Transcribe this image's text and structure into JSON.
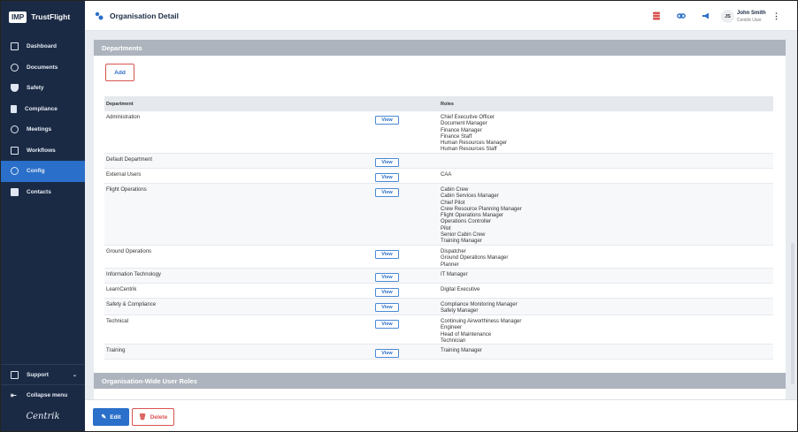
{
  "brand": {
    "logo_text": "IMP",
    "name": "TrustFlight"
  },
  "sidebar": {
    "items": [
      {
        "label": "Dashboard",
        "icon": "dashboard-icon"
      },
      {
        "label": "Documents",
        "icon": "paperclip-icon"
      },
      {
        "label": "Safety",
        "icon": "shield-icon"
      },
      {
        "label": "Compliance",
        "icon": "clipboard-icon"
      },
      {
        "label": "Meetings",
        "icon": "people-icon"
      },
      {
        "label": "Workflows",
        "icon": "workflow-icon"
      },
      {
        "label": "Config",
        "icon": "config-icon"
      },
      {
        "label": "Contacts",
        "icon": "contact-card-icon"
      }
    ],
    "active": "Config",
    "support_label": "Support",
    "collapse_label": "Collapse menu",
    "footer_logo": "Centrik"
  },
  "header": {
    "title": "Organisation Detail",
    "user": {
      "initials": "JS",
      "name": "John Smith",
      "role": "Centrik User"
    }
  },
  "departments": {
    "heading": "Departments",
    "add_label": "Add",
    "columns": {
      "department": "Department",
      "roles": "Roles"
    },
    "view_label": "View",
    "rows": [
      {
        "name": "Administration",
        "roles": [
          "Chief Executive Officer",
          "Document Manager",
          "Finance Manager",
          "Finance Staff",
          "Human Resources Manager",
          "Human Resources Staff"
        ]
      },
      {
        "name": "Default Department",
        "roles": []
      },
      {
        "name": "External Users",
        "roles": [
          "CAA"
        ]
      },
      {
        "name": "Flight Operations",
        "roles": [
          "Cabin Crew",
          "Cabin Services Manager",
          "Chief Pilot",
          "Crew Resource Planning Manager",
          "Flight Operations Manager",
          "Operations Controller",
          "Pilot",
          "Senior Cabin Crew",
          "Training Manager"
        ]
      },
      {
        "name": "Ground Operations",
        "roles": [
          "Dispatcher",
          "Ground Operations Manager",
          "Planner"
        ]
      },
      {
        "name": "Information Technology",
        "roles": [
          "IT Manager"
        ]
      },
      {
        "name": "LearnCentrik",
        "roles": [
          "Digital Executive"
        ]
      },
      {
        "name": "Safety & Compliance",
        "roles": [
          "Compliance Monitoring Manager",
          "Safety Manager"
        ]
      },
      {
        "name": "Technical",
        "roles": [
          "Continuing Airworthiness Manager",
          "Engineer",
          "Head of Maintenance",
          "Technician"
        ]
      },
      {
        "name": "Training",
        "roles": [
          "Training Manager"
        ]
      }
    ]
  },
  "org_roles": {
    "heading": "Organisation-Wide User Roles"
  },
  "footer": {
    "edit_label": "Edit",
    "delete_label": "Delete"
  },
  "colors": {
    "sidebar": "#1b2a44",
    "accent": "#2a6fc9",
    "danger": "#d9534f",
    "panel_header": "#adb4bd"
  }
}
